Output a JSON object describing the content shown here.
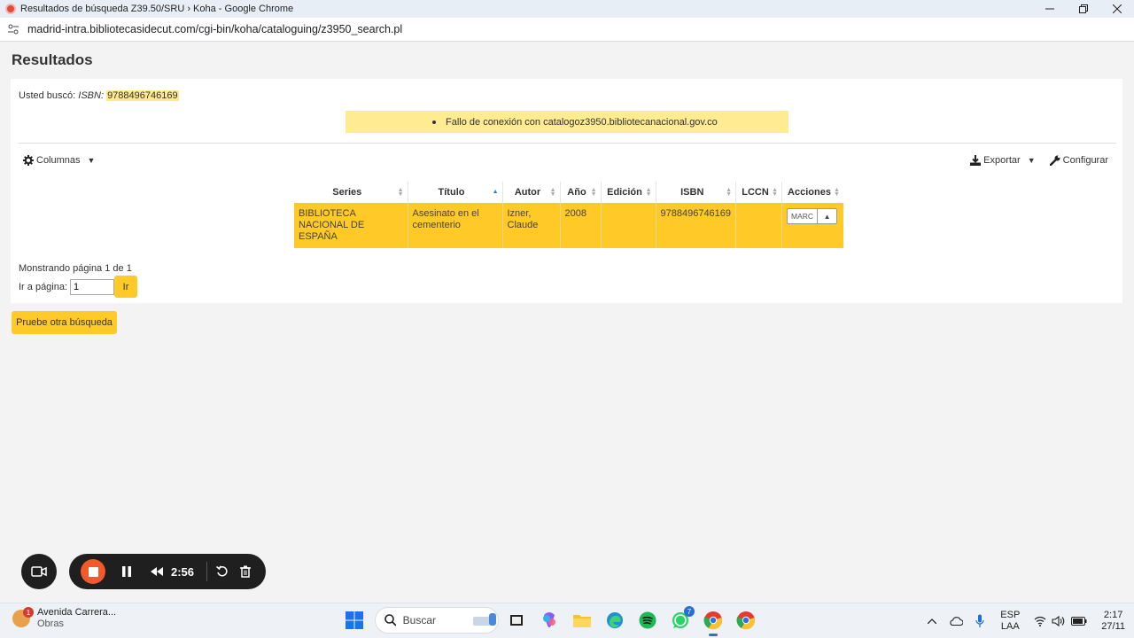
{
  "window": {
    "title": "Resultados de búsqueda Z39.50/SRU › Koha - Google Chrome",
    "url": "madrid-intra.bibliotecasidecut.com/cgi-bin/koha/cataloguing/z3950_search.pl"
  },
  "page": {
    "title": "Resultados",
    "searched_prefix": "Usted buscó:",
    "searched_field": "ISBN:",
    "searched_value": "9788496746169",
    "alert_message": "Fallo de conexión con catalogoz3950.bibliotecanacional.gov.co"
  },
  "toolbar": {
    "columns_label": "Columnas",
    "export_label": "Exportar",
    "configure_label": "Configurar"
  },
  "table": {
    "headers": [
      "Series",
      "Título",
      "Autor",
      "Año",
      "Edición",
      "ISBN",
      "LCCN",
      "Acciones"
    ],
    "rows": [
      {
        "series": "BIBLIOTECA NACIONAL DE ESPAÑA",
        "title": "Asesinato en el cementerio",
        "author": "Izner, Claude",
        "year": "2008",
        "edition": "",
        "isbn": "9788496746169",
        "lccn": "",
        "action_label": "MARC"
      }
    ]
  },
  "pagination": {
    "showing": "Monstrando página 1 de 1",
    "goto_label": "Ir a página:",
    "goto_value": "1",
    "go_button": "Ir"
  },
  "retry_button": "Pruebe otra búsqueda",
  "recorder": {
    "time": "2:56"
  },
  "taskbar": {
    "weather_title": "Avenida Carrera...",
    "weather_sub": "Obras",
    "weather_badge": "1",
    "search_label": "Buscar",
    "whatsapp_badge": "7",
    "lang_top": "ESP",
    "lang_bottom": "LAA",
    "time": "2:17",
    "date": "27/11"
  },
  "colors": {
    "accent": "#ffc927",
    "alert_bg": "#ffeb91",
    "record_stop": "#f25a2a"
  }
}
